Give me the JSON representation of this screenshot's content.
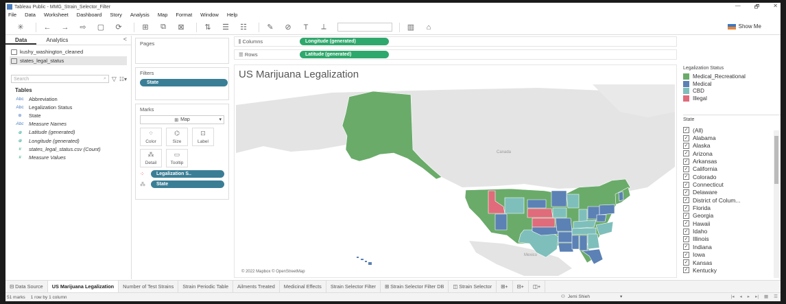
{
  "window": {
    "title": "Tableau Public - MMG_Strain_Selector_Filter",
    "controls": [
      "—",
      "🗗",
      "✕"
    ]
  },
  "menu": [
    "File",
    "Data",
    "Worksheet",
    "Dashboard",
    "Story",
    "Analysis",
    "Map",
    "Format",
    "Window",
    "Help"
  ],
  "toolbar": {
    "show_me": "Show Me"
  },
  "data_pane": {
    "tabs": [
      "Data",
      "Analytics"
    ],
    "collapse": "<",
    "sources": [
      "kushy_washington_cleaned",
      "states_legal_status"
    ],
    "search_placeholder": "Search",
    "tables_heading": "Tables",
    "fields": [
      {
        "type": "Abc",
        "name": "Abbreviation"
      },
      {
        "type": "Abc",
        "name": "Legalization Status"
      },
      {
        "type": "globe",
        "name": "State"
      },
      {
        "type": "Abc",
        "name": "Measure Names"
      },
      {
        "type": "globe",
        "name": "Latitude (generated)"
      },
      {
        "type": "globe",
        "name": "Longitude (generated)"
      },
      {
        "type": "#",
        "name": "states_legal_status.csv (Count)"
      },
      {
        "type": "#",
        "name": "Measure Values"
      }
    ]
  },
  "cards": {
    "pages": "Pages",
    "filters": "Filters",
    "filter_pill": "State",
    "marks": "Marks",
    "mark_type": "Map",
    "mark_buttons": [
      "Color",
      "Size",
      "Label",
      "Detail",
      "Tooltip"
    ],
    "mark_pills": [
      "Legalization S..",
      "State"
    ]
  },
  "shelves": {
    "columns_label": "Columns",
    "columns_pill": "Longitude (generated)",
    "rows_label": "Rows",
    "rows_pill": "Latitude (generated)"
  },
  "viz": {
    "title": "US Marijuana Legalization",
    "credit": "© 2022 Mapbox © OpenStreetMap",
    "labels": {
      "canada": "Canada",
      "mexico": "Mexico"
    }
  },
  "legend": {
    "title": "Legalization Status",
    "items": [
      {
        "label": "Medical_Recreational",
        "color": "#6aab6a"
      },
      {
        "label": "Medical",
        "color": "#5b81b5"
      },
      {
        "label": "CBD",
        "color": "#7fbfbb"
      },
      {
        "label": "Illegal",
        "color": "#e06b7a"
      }
    ]
  },
  "state_filter": {
    "title": "State",
    "items": [
      "(All)",
      "Alabama",
      "Alaska",
      "Arizona",
      "Arkansas",
      "California",
      "Colorado",
      "Connecticut",
      "Delaware",
      "District of Colum...",
      "Florida",
      "Georgia",
      "Hawaii",
      "Idaho",
      "Illinois",
      "Indiana",
      "Iowa",
      "Kansas",
      "Kentucky"
    ]
  },
  "sheet_tabs": [
    "Data Source",
    "US Marijuana Legalization",
    "Number of Test Strains",
    "Strain Periodic Table",
    "Ailments Treated",
    "Medicinal Effects",
    "Strain Selector Filter",
    "Strain Selector Filter DB",
    "Strain Selector"
  ],
  "status": {
    "marks": "51 marks",
    "rows": "1 row by 1 column",
    "user": "Jemi Shieh"
  }
}
